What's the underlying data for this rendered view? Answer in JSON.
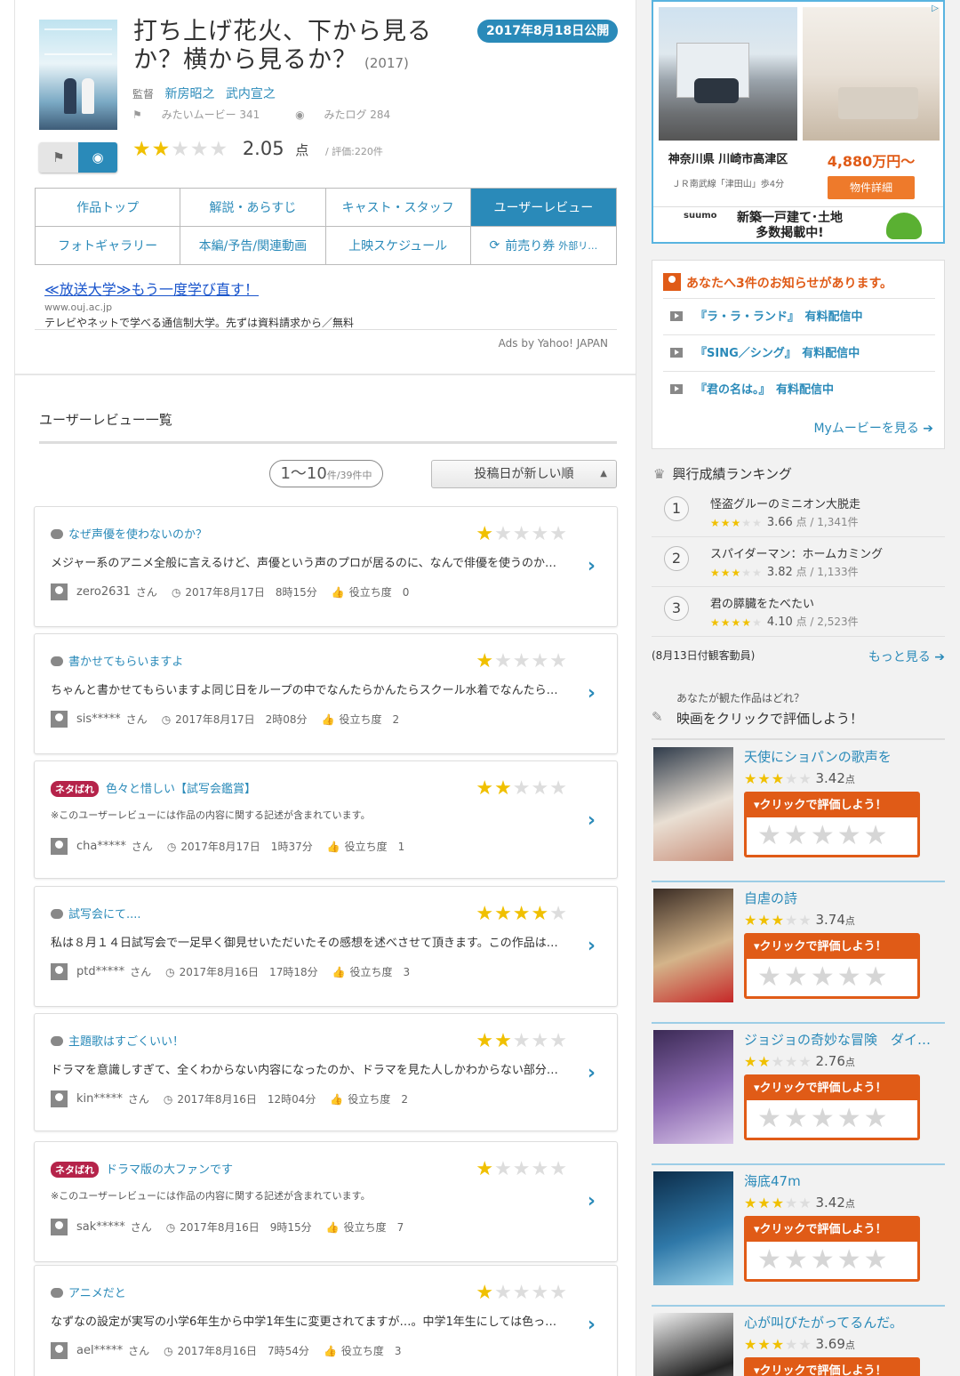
{
  "header": {
    "title": "打ち上げ花火、下から見るか？横から見るか？",
    "year": "(2017)",
    "release_badge": "2017年8月18日公開",
    "director_label": "監督",
    "directors": [
      "新房昭之",
      "武内宣之"
    ],
    "watch_want": "みたいムービー 341",
    "watched_log": "みたログ 284",
    "stars": 2,
    "score": "2.05",
    "score_unit": "点",
    "score_count": "/ 評価:220件"
  },
  "nav_tabs": [
    {
      "label": "作品トップ",
      "active": false
    },
    {
      "label": "解説・あらすじ",
      "active": false
    },
    {
      "label": "キャスト・スタッフ",
      "active": false
    },
    {
      "label": "ユーザーレビュー",
      "active": true
    },
    {
      "label": "フォトギャラリー",
      "active": false
    },
    {
      "label": "本編/予告/関連動画",
      "active": false
    },
    {
      "label": "上映スケジュール",
      "active": false
    },
    {
      "label": "前売り券",
      "sub": "外部リ…",
      "active": false
    }
  ],
  "ad": {
    "title": "≪放送大学≫もう一度学び直す！",
    "url": "www.ouj.ac.jp",
    "desc": "テレビやネットで学べる通信制大学。先ずは資料請求から／無料",
    "by": "Ads by Yahoo! JAPAN"
  },
  "list": {
    "heading": "ユーザーレビュー一覧",
    "pager_range": "1〜10",
    "pager_total": "件/39件中",
    "sort_label": "投稿日が新しい順"
  },
  "reviews": [
    {
      "title": "なぜ声優を使わないのか？",
      "spoiler": false,
      "stars": 1,
      "body": "メジャー系のアニメ全般に言えるけど、声優という声のプロが居るのに、なんで俳優を使うのか…",
      "user": "zero2631",
      "date": "2017年8月17日　8時15分",
      "helpful": "役立ち度　0"
    },
    {
      "title": "書かせてもらいますよ",
      "spoiler": false,
      "stars": 1,
      "body": "ちゃんと書かせてもらいますよ同じ日をループの中でなんたらかんたらスクール水着でなんたら…",
      "user": "sis*****",
      "date": "2017年8月17日　2時08分",
      "helpful": "役立ち度　2"
    },
    {
      "title": "色々と惜しい【試写会鑑賞】",
      "spoiler": true,
      "stars": 2,
      "body": "※このユーザーレビューには作品の内容に関する記述が含まれています。",
      "user": "cha*****",
      "date": "2017年8月17日　1時37分",
      "helpful": "役立ち度　1"
    },
    {
      "title": "試写会にて....",
      "spoiler": false,
      "stars": 4,
      "body": "私は８月１４日試写会で一足早く御見せいただいたその感想を述べさせて頂きます。この作品は…",
      "user": "ptd*****",
      "date": "2017年8月16日　17時18分",
      "helpful": "役立ち度　3"
    },
    {
      "title": "主題歌はすごくいい！",
      "spoiler": false,
      "stars": 2,
      "body": "ドラマを意識しすぎて、全くわからない内容になったのか、ドラマを見た人しかわからない部分…",
      "user": "kin*****",
      "date": "2017年8月16日　12時04分",
      "helpful": "役立ち度　2"
    },
    {
      "title": "ドラマ版の大ファンです",
      "spoiler": true,
      "stars": 1,
      "body": "※このユーザーレビューには作品の内容に関する記述が含まれています。",
      "user": "sak*****",
      "date": "2017年8月16日　9時15分",
      "helpful": "役立ち度　7"
    },
    {
      "title": "アニメだと",
      "spoiler": false,
      "stars": 1,
      "body": "なずなの設定が実写の小学6年生から中学1年生に変更されてますが…。中学1年生にしては色っ…",
      "user": "ael*****",
      "date": "2017年8月16日　7時54分",
      "helpful": "役立ち度　3"
    }
  ],
  "review_labels": {
    "spoiler": "ネタばれ",
    "san": "さん"
  },
  "sidebar": {
    "ad": {
      "location": "神奈川県 川崎市高津区",
      "station": "ＪＲ南武線「津田山」歩4分",
      "price": "4,880万円〜",
      "button": "物件詳細",
      "brand": "suumo",
      "banner": "新築一戸建て･土地\n多数掲載中!"
    },
    "notice": {
      "heading": "あなたへ3件のお知らせがあります。",
      "items": [
        "『ラ・ラ・ランド』　有料配信中",
        "『SING／シング』　有料配信中",
        "『君の名は。』　有料配信中"
      ],
      "more": "Myムービーを見る ➔"
    },
    "ranking": {
      "heading": "興行成績ランキング",
      "items": [
        {
          "rank": "1",
          "title": "怪盗グルーのミニオン大脱走",
          "stars": 3.5,
          "score": "3.66",
          "meta": "点 / 1,341件"
        },
        {
          "rank": "2",
          "title": "スパイダーマン：ホームカミング",
          "stars": 3.5,
          "score": "3.82",
          "meta": "点 / 1,133件"
        },
        {
          "rank": "3",
          "title": "君の膵臓をたべたい",
          "stars": 4,
          "score": "4.10",
          "meta": "点 / 2,523件"
        }
      ],
      "date_note": "(8月13日付観客動員)",
      "more": "もっと見る ➔"
    },
    "prompt": {
      "question": "あなたが観た作品はどれ？",
      "action": "映画をクリックで評価しよう！"
    },
    "rate_label": "▾クリックで評価しよう！",
    "movies": [
      {
        "title": "天使にショパンの歌声を",
        "stars": 3,
        "score": "3.42",
        "poster_colors": [
          "#2f3b4a",
          "#e9dfd3",
          "#c98f7a"
        ]
      },
      {
        "title": "自虐の詩",
        "stars": 3.5,
        "score": "3.74",
        "poster_colors": [
          "#3a2c24",
          "#d4b48a",
          "#c62828"
        ]
      },
      {
        "title": "ジョジョの奇妙な冒険　ダイ…",
        "stars": 2.5,
        "score": "2.76",
        "poster_colors": [
          "#3b2a55",
          "#8e6cb3",
          "#d9c6e8"
        ]
      },
      {
        "title": "海底47m",
        "stars": 3,
        "score": "3.42",
        "poster_colors": [
          "#0c2d4a",
          "#2f78a8",
          "#9dd4ea"
        ]
      },
      {
        "title": "心が叫びたがってるんだ。",
        "stars": 3.5,
        "score": "3.69",
        "poster_colors": [
          "#f2f2f2",
          "#222",
          "#ddd"
        ]
      }
    ],
    "score_unit": "点"
  }
}
